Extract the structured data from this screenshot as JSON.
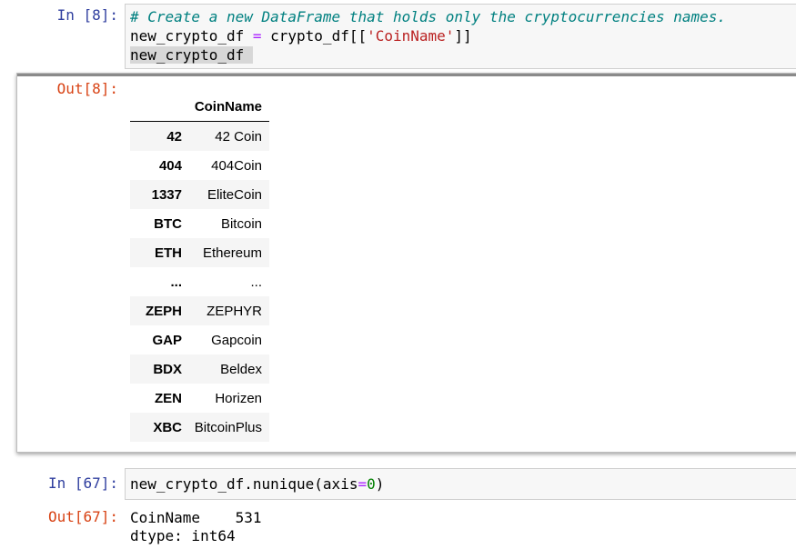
{
  "cell8": {
    "in_prompt": "In [8]:",
    "code": {
      "comment": "# Create a new DataFrame that holds only the cryptocurrencies names.",
      "line2_a": "new_crypto_df ",
      "line2_eq": "=",
      "line2_b": " crypto_df[[",
      "line2_str": "'CoinName'",
      "line2_c": "]]",
      "line3": "new_crypto_df "
    },
    "out_prompt": "Out[8]:",
    "dataframe": {
      "column": "CoinName",
      "rows": [
        {
          "index": "42",
          "CoinName": "42 Coin"
        },
        {
          "index": "404",
          "CoinName": "404Coin"
        },
        {
          "index": "1337",
          "CoinName": "EliteCoin"
        },
        {
          "index": "BTC",
          "CoinName": "Bitcoin"
        },
        {
          "index": "ETH",
          "CoinName": "Ethereum"
        },
        {
          "index": "...",
          "CoinName": "..."
        },
        {
          "index": "ZEPH",
          "CoinName": "ZEPHYR"
        },
        {
          "index": "GAP",
          "CoinName": "Gapcoin"
        },
        {
          "index": "BDX",
          "CoinName": "Beldex"
        },
        {
          "index": "ZEN",
          "CoinName": "Horizen"
        },
        {
          "index": "XBC",
          "CoinName": "BitcoinPlus"
        }
      ]
    }
  },
  "cell67": {
    "in_prompt": "In [67]:",
    "code": {
      "a": "new_crypto_df.nunique(axis",
      "eq": "=",
      "num": "0",
      "b": ")"
    },
    "out_prompt": "Out[67]:",
    "output": {
      "line1": "CoinName    531",
      "line2": "dtype: int64"
    }
  },
  "colors": {
    "in_prompt": "#303f9f",
    "out_prompt": "#d84315",
    "comment": "#008080",
    "string": "#ba2121",
    "number": "#008000",
    "operator": "#aa22ff"
  }
}
